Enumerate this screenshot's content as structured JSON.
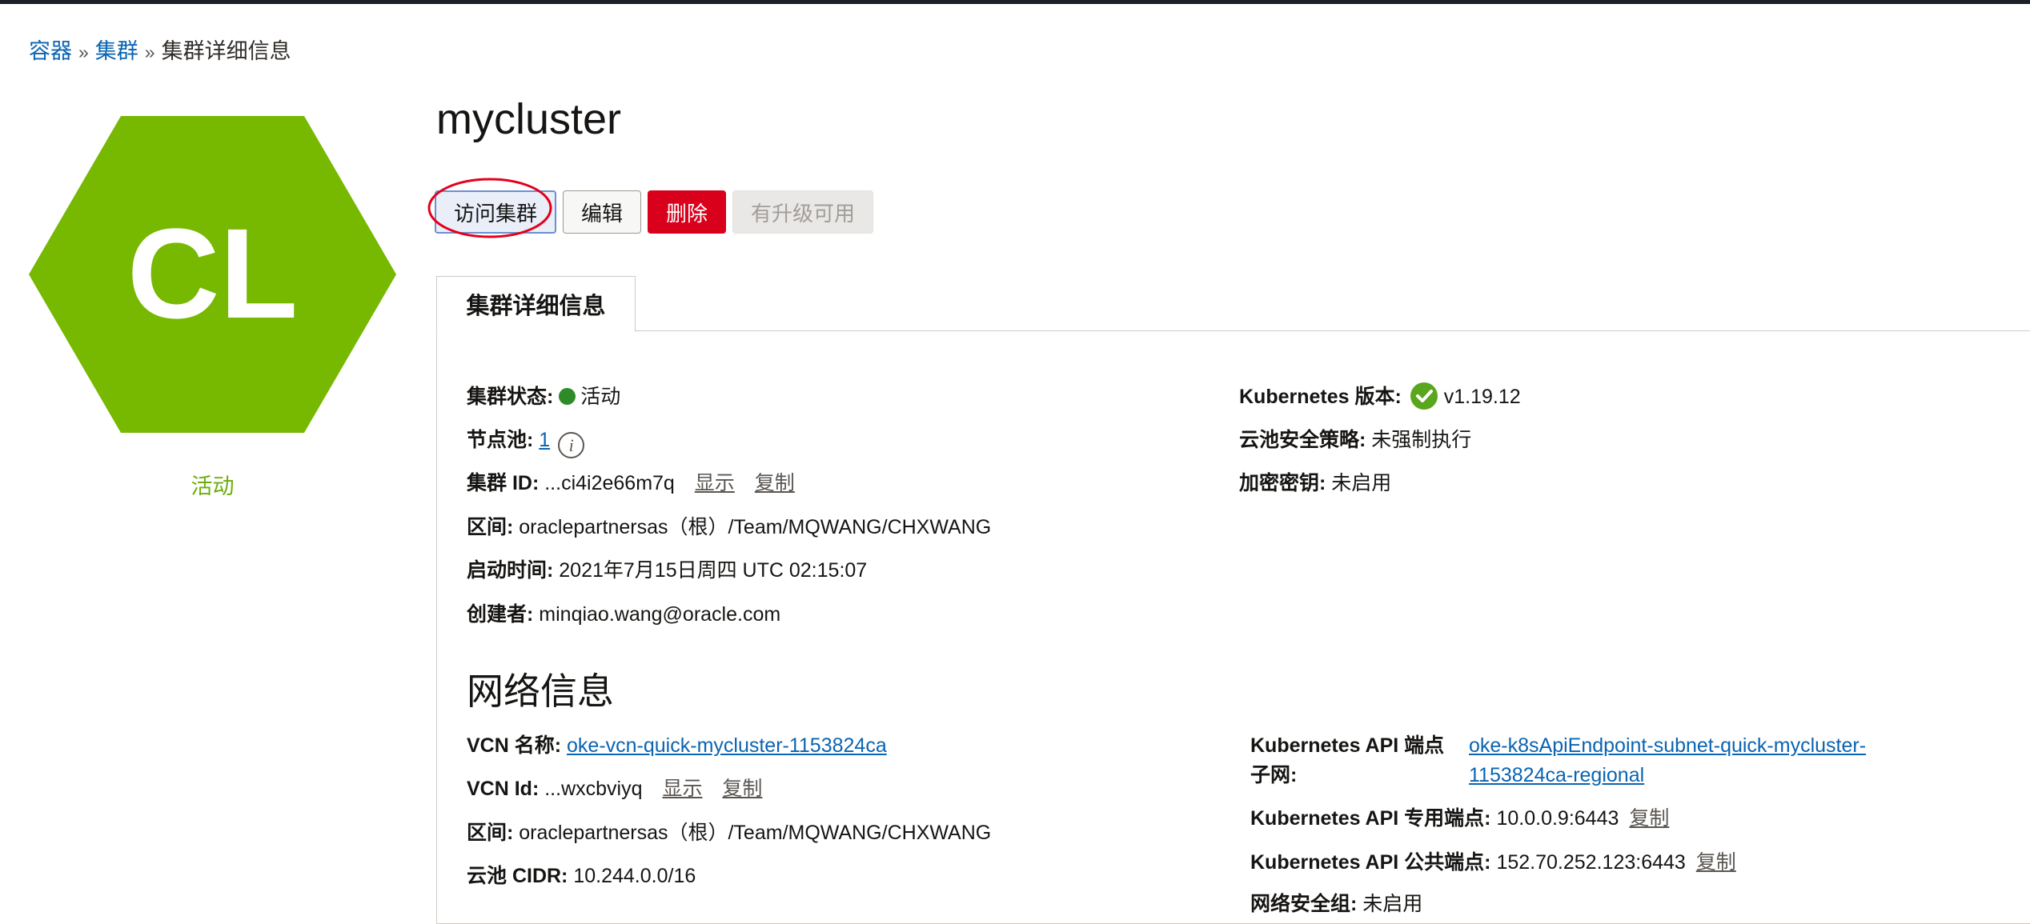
{
  "breadcrumb": {
    "items": [
      "容器",
      "集群",
      "集群详细信息"
    ],
    "separator": "»"
  },
  "resource_icon": {
    "initials": "CL",
    "status": "活动",
    "color": "#76b900"
  },
  "page_title": "mycluster",
  "actions": {
    "access": "访问集群",
    "edit": "编辑",
    "delete": "删除",
    "upgrade": "有升级可用"
  },
  "tab": {
    "label": "集群详细信息"
  },
  "details": {
    "status_label": "集群状态:",
    "status_value": "活动",
    "node_pool_label": "节点池:",
    "node_pool_value": "1",
    "cluster_id_label": "集群 ID:",
    "cluster_id_value": "...ci4i2e66m7q",
    "show": "显示",
    "copy": "复制",
    "compartment_label": "区间:",
    "compartment_value": "oraclepartnersas（根）/Team/MQWANG/CHXWANG",
    "created_label": "启动时间:",
    "created_value": "2021年7月15日周四 UTC 02:15:07",
    "creator_label": "创建者:",
    "creator_value": "minqiao.wang@oracle.com",
    "k8s_version_label": "Kubernetes 版本:",
    "k8s_version_value": "v1.19.12",
    "pod_security_label": "云池安全策略:",
    "pod_security_value": "未强制执行",
    "encryption_label": "加密密钥:",
    "encryption_value": "未启用"
  },
  "network": {
    "section_title": "网络信息",
    "vcn_name_label": "VCN 名称:",
    "vcn_name_value": "oke-vcn-quick-mycluster-1153824ca",
    "vcn_id_label": "VCN Id:",
    "vcn_id_value": "...wxcbviyq",
    "show": "显示",
    "copy": "复制",
    "compartment_label": "区间:",
    "compartment_value": "oraclepartnersas（根）/Team/MQWANG/CHXWANG",
    "pods_cidr_label": "云池 CIDR:",
    "pods_cidr_value": "10.244.0.0/16",
    "api_subnet_label_1": "Kubernetes API 端点",
    "api_subnet_label_2": "子网:",
    "api_subnet_value_1": "oke-k8sApiEndpoint-subnet-quick-mycluster-",
    "api_subnet_value_2": "1153824ca-regional",
    "private_endpoint_label": "Kubernetes API 专用端点:",
    "private_endpoint_value": "10.0.0.9:6443",
    "public_endpoint_label": "Kubernetes API 公共端点:",
    "public_endpoint_value": "152.70.252.123:6443",
    "nsg_label": "网络安全组:",
    "nsg_value": "未启用"
  }
}
